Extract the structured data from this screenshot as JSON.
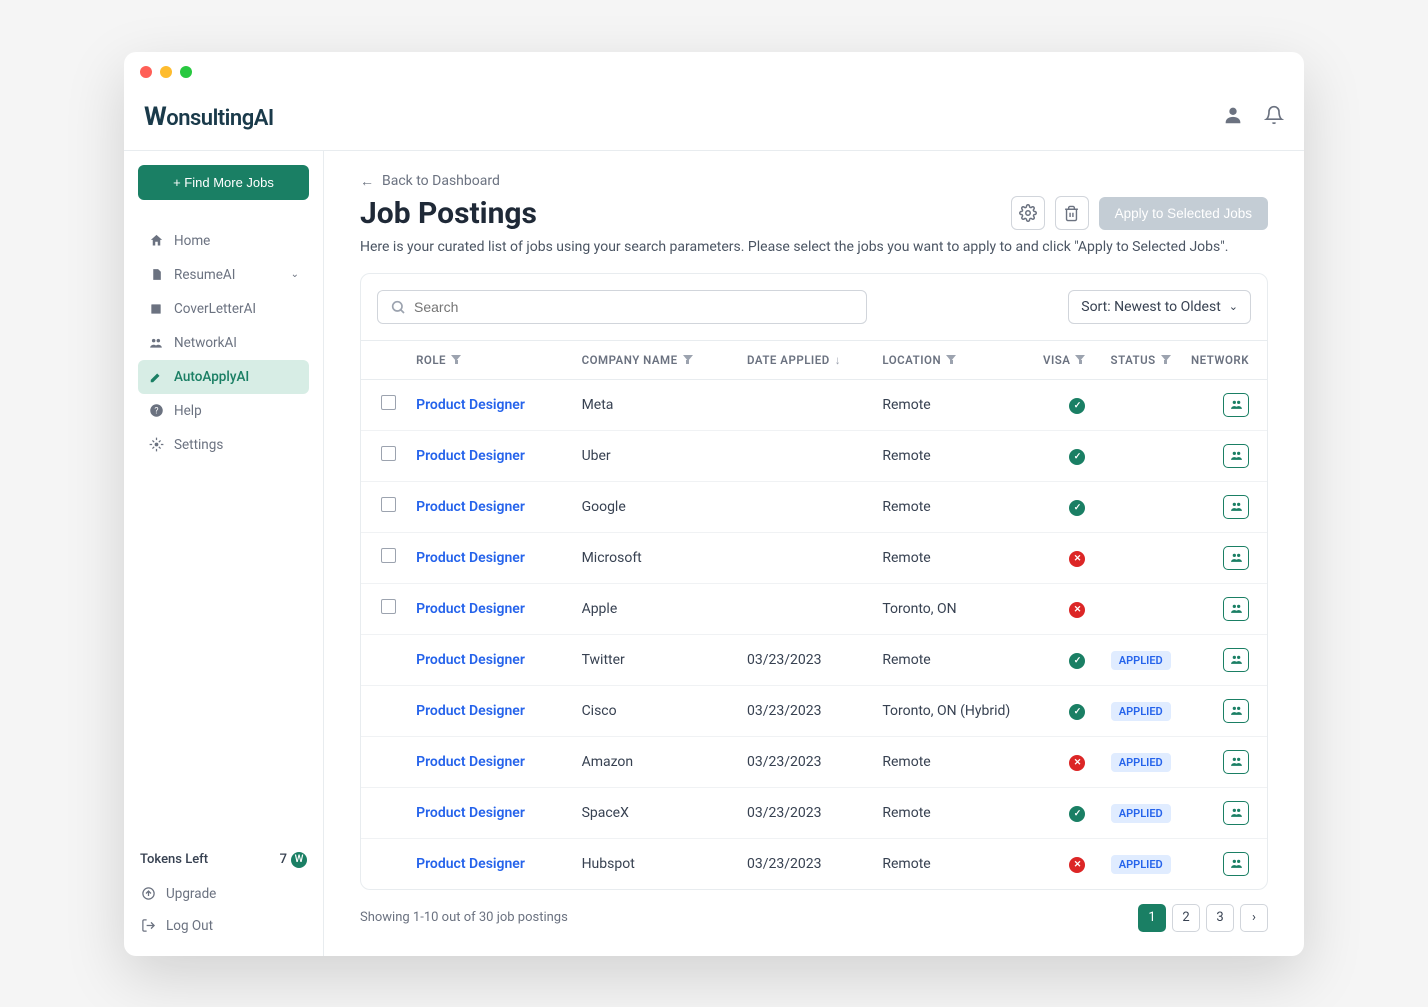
{
  "app": {
    "logo": "WonsultingAI"
  },
  "header": {
    "user_icon": "person-icon",
    "bell_icon": "bell-icon"
  },
  "sidebar": {
    "cta": "+ Find More Jobs",
    "items": [
      {
        "label": "Home",
        "icon": "home"
      },
      {
        "label": "ResumeAI",
        "icon": "file",
        "expandable": true
      },
      {
        "label": "CoverLetterAI",
        "icon": "doc"
      },
      {
        "label": "NetworkAI",
        "icon": "people"
      },
      {
        "label": "AutoApplyAI",
        "icon": "edit",
        "active": true
      },
      {
        "label": "Help",
        "icon": "help"
      },
      {
        "label": "Settings",
        "icon": "gear"
      }
    ],
    "tokens_label": "Tokens Left",
    "tokens_value": "7",
    "bottom": [
      {
        "label": "Upgrade",
        "icon": "upgrade"
      },
      {
        "label": "Log Out",
        "icon": "logout"
      }
    ]
  },
  "main": {
    "back_label": "Back to Dashboard",
    "title": "Job Postings",
    "apply_button": "Apply to Selected Jobs",
    "subtitle": "Here is your curated list of jobs using your search parameters. Please select the jobs you want to apply to and click \"Apply to Selected Jobs\".",
    "search_placeholder": "Search",
    "sort_label": "Sort: Newest to Oldest",
    "columns": {
      "role": "ROLE",
      "company": "COMPANY  NAME",
      "date": "DATE APPLIED",
      "location": "LOCATION",
      "visa": "VISA",
      "status": "STATUS",
      "network": "NETWORK"
    },
    "rows": [
      {
        "role": "Product Designer",
        "company": "Meta",
        "date": "",
        "location": "Remote",
        "visa": true,
        "status": "",
        "selectable": true
      },
      {
        "role": "Product Designer",
        "company": "Uber",
        "date": "",
        "location": "Remote",
        "visa": true,
        "status": "",
        "selectable": true
      },
      {
        "role": "Product Designer",
        "company": "Google",
        "date": "",
        "location": "Remote",
        "visa": true,
        "status": "",
        "selectable": true
      },
      {
        "role": "Product Designer",
        "company": "Microsoft",
        "date": "",
        "location": "Remote",
        "visa": false,
        "status": "",
        "selectable": true
      },
      {
        "role": "Product Designer",
        "company": "Apple",
        "date": "",
        "location": "Toronto, ON",
        "visa": false,
        "status": "",
        "selectable": true
      },
      {
        "role": "Product Designer",
        "company": "Twitter",
        "date": "03/23/2023",
        "location": "Remote",
        "visa": true,
        "status": "APPLIED",
        "selectable": false
      },
      {
        "role": "Product Designer",
        "company": "Cisco",
        "date": "03/23/2023",
        "location": "Toronto, ON (Hybrid)",
        "visa": true,
        "status": "APPLIED",
        "selectable": false
      },
      {
        "role": "Product Designer",
        "company": "Amazon",
        "date": "03/23/2023",
        "location": "Remote",
        "visa": false,
        "status": "APPLIED",
        "selectable": false
      },
      {
        "role": "Product Designer",
        "company": "SpaceX",
        "date": "03/23/2023",
        "location": "Remote",
        "visa": true,
        "status": "APPLIED",
        "selectable": false
      },
      {
        "role": "Product Designer",
        "company": "Hubspot",
        "date": "03/23/2023",
        "location": "Remote",
        "visa": false,
        "status": "APPLIED",
        "selectable": false
      }
    ],
    "footer_text": "Showing 1-10 out of 30 job postings",
    "pages": [
      "1",
      "2",
      "3"
    ]
  }
}
